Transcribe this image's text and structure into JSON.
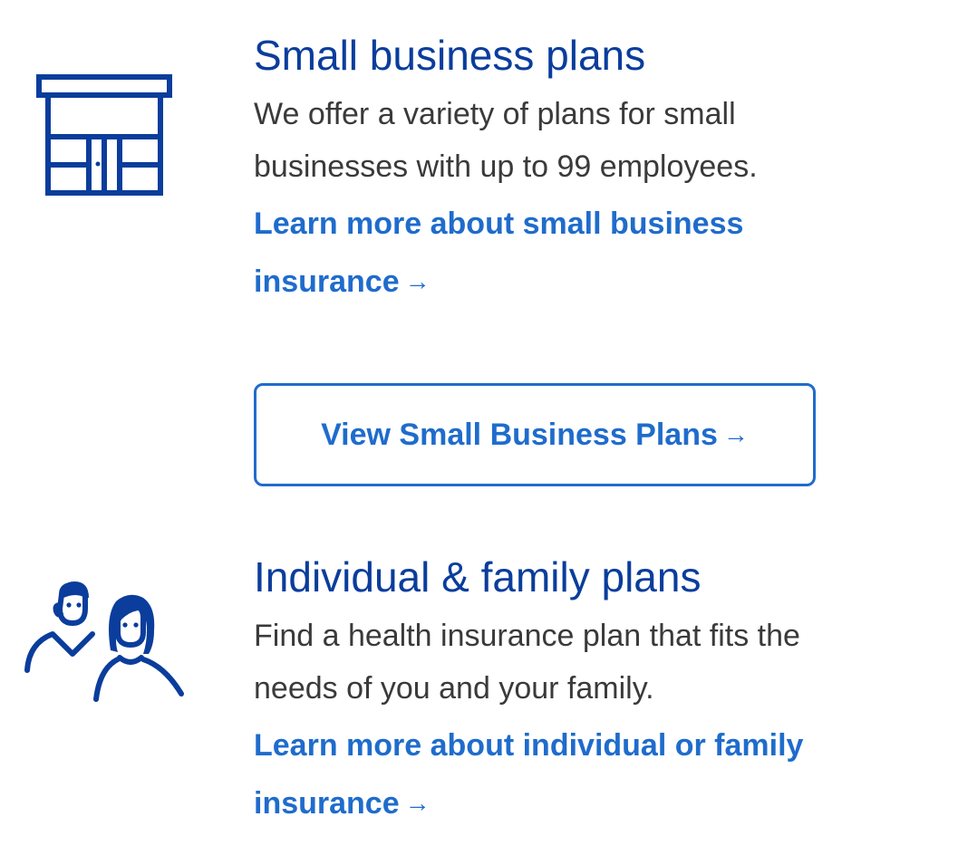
{
  "colors": {
    "heading": "#0a3d9c",
    "body_text": "#3a3a3a",
    "link": "#1f6ccc",
    "icon": "#0a3d9c"
  },
  "sections": [
    {
      "icon": "storefront-icon",
      "title": "Small business plans",
      "description": "We offer a variety of plans for small businesses with up to 99 employees.",
      "link_label": "Learn more about small business insurance",
      "link_arrow": "→",
      "button_label": "View Small Business Plans",
      "button_arrow": "→"
    },
    {
      "icon": "family-icon",
      "title": "Individual & family plans",
      "description": "Find a health insurance plan that fits the needs of you and your family.",
      "link_label": "Learn more about individual or family insurance",
      "link_arrow": "→"
    }
  ]
}
